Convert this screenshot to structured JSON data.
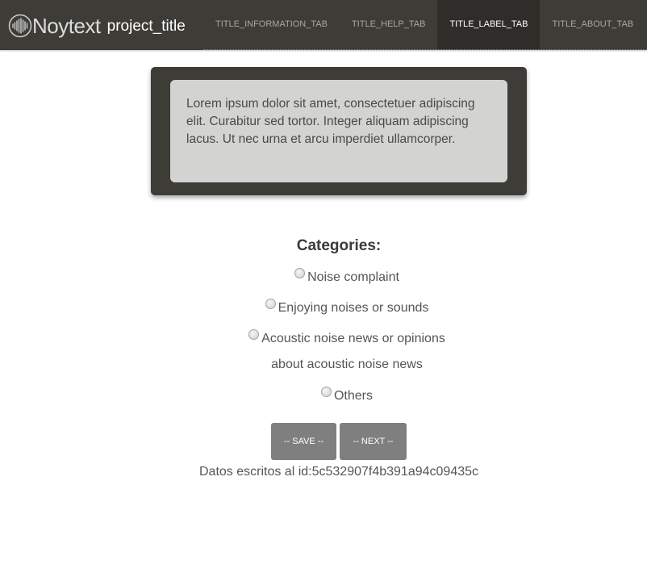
{
  "header": {
    "brand_name": "Noytext",
    "project_title": "project_title",
    "logo_icon": "soundwave-icon",
    "background_color": "#3d3c37",
    "tabs": [
      {
        "label": "TITLE_INFORMATION_TAB",
        "active": false
      },
      {
        "label": "TITLE_HELP_TAB",
        "active": false
      },
      {
        "label": "TITLE_LABEL_TAB",
        "active": true
      },
      {
        "label": "TITLE_ABOUT_TAB",
        "active": false
      }
    ]
  },
  "text_card": {
    "text": "Lorem ipsum dolor sit amet, consectetuer adipiscing elit. Curabitur sed tortor. Integer aliquam adipiscing lacus. Ut nec urna et arcu imperdiet ullamcorper."
  },
  "categories": {
    "title": "Categories:",
    "options": [
      {
        "label": "Noise complaint",
        "checked": false
      },
      {
        "label": "Enjoying noises or sounds",
        "checked": false
      },
      {
        "label": "Acoustic noise news or opinions",
        "sublabel": "about acoustic noise news",
        "checked": false
      },
      {
        "label": "Others",
        "checked": false
      }
    ]
  },
  "actions": {
    "save_label": "-- SAVE --",
    "next_label": "-- NEXT --",
    "button_color": "#7f7f7f"
  },
  "status": {
    "message": "Datos escritos al id:5c532907f4b391a94c09435c"
  }
}
